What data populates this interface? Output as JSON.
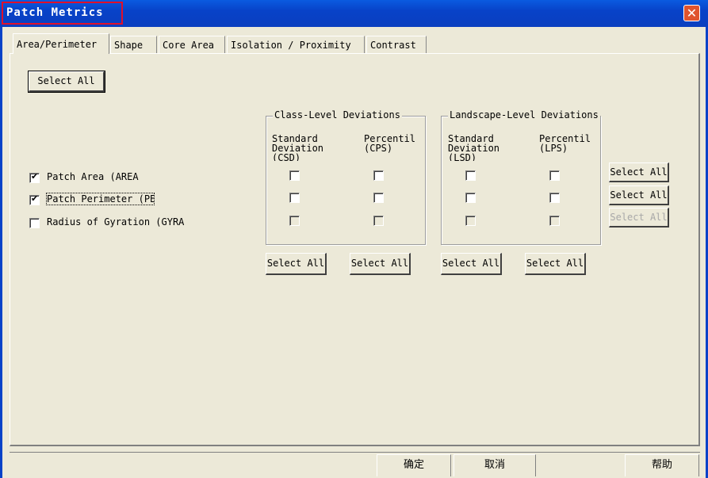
{
  "window": {
    "title": "Patch Metrics",
    "close_icon": "close-icon"
  },
  "tabs": [
    {
      "label": "Area/Perimeter",
      "active": true
    },
    {
      "label": "Shape"
    },
    {
      "label": "Core Area"
    },
    {
      "label": "Isolation / Proximity"
    },
    {
      "label": "Contrast"
    }
  ],
  "panel": {
    "select_all_top": "Select All",
    "class_group": {
      "title": "Class-Level Deviations",
      "col1_head": "Standard\nDeviation\n(CSD)",
      "col2_head": "Percentil\n(CPS)",
      "select_all_1": "Select All",
      "select_all_2": "Select All"
    },
    "landscape_group": {
      "title": "Landscape-Level Deviations",
      "col1_head": "Standard\nDeviation\n(LSD)",
      "col2_head": "Percentil\n(LPS)",
      "select_all_1": "Select All",
      "select_all_2": "Select All"
    },
    "metrics": [
      {
        "label": "Patch Area  (AREA",
        "checked": true,
        "enabled": true,
        "row_select_all": "Select All"
      },
      {
        "label": "Patch Perimeter  (PER)",
        "checked": true,
        "enabled": true,
        "row_select_all": "Select All"
      },
      {
        "label": "Radius of Gyration  (GYRA",
        "checked": false,
        "enabled": false,
        "row_select_all": "Select All"
      }
    ]
  },
  "footer": {
    "ok": "确定",
    "cancel": "取消",
    "help": "帮助"
  }
}
